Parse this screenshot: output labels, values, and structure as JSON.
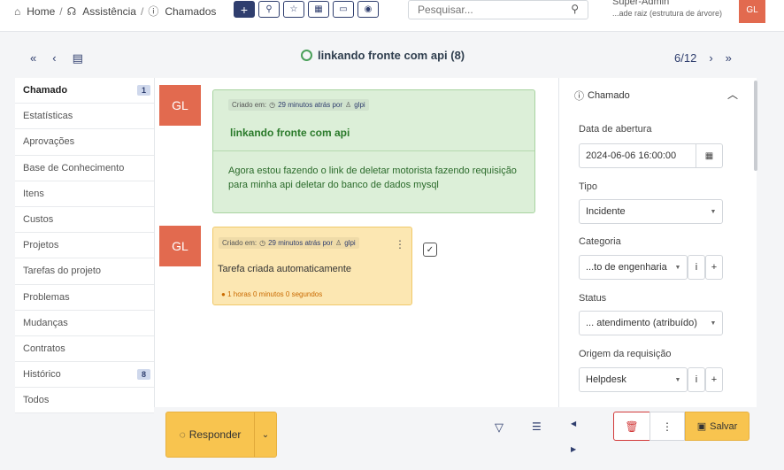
{
  "breadcrumb": {
    "home": "Home",
    "assistance": "Assistência",
    "tickets": "Chamados"
  },
  "search": {
    "placeholder": "Pesquisar..."
  },
  "user": {
    "name": "Super-Admin",
    "entity": "...ade raiz (estrutura de árvore)",
    "initials": "GL"
  },
  "ticket": {
    "title": "linkando fronte com api (8)",
    "position": "6/12"
  },
  "tabs": [
    {
      "label": "Chamado",
      "badge": "1"
    },
    {
      "label": "Estatísticas"
    },
    {
      "label": "Aprovações"
    },
    {
      "label": "Base de Conhecimento"
    },
    {
      "label": "Itens"
    },
    {
      "label": "Custos"
    },
    {
      "label": "Projetos"
    },
    {
      "label": "Tarefas do projeto"
    },
    {
      "label": "Problemas"
    },
    {
      "label": "Mudanças"
    },
    {
      "label": "Contratos"
    },
    {
      "label": "Histórico",
      "badge": "8"
    },
    {
      "label": "Todos"
    }
  ],
  "followup": {
    "avatar": "GL",
    "created_label": "Criado em:",
    "time_ago": "29 minutos atrás por",
    "author": "glpi",
    "title": "linkando fronte com api",
    "body": "Agora estou fazendo o link de deletar motorista fazendo requisição para minha api deletar do banco de dados mysql"
  },
  "task": {
    "avatar": "GL",
    "created_label": "Criado em:",
    "time_ago": "29 minutos atrás por",
    "author": "glpi",
    "body": "Tarefa criada automaticamente",
    "timer": "1 horas 0 minutos 0 segundos"
  },
  "actions": {
    "reply": "Responder",
    "save": "Salvar"
  },
  "panel": {
    "header": "Chamado",
    "open_date_label": "Data de abertura",
    "open_date": "2024-06-06 16:00:00",
    "type_label": "Tipo",
    "type": "Incidente",
    "category_label": "Categoria",
    "category": "...to de engenharia",
    "status_label": "Status",
    "status": "... atendimento (atribuído)",
    "origin_label": "Origem da requisição",
    "origin": "Helpdesk"
  }
}
